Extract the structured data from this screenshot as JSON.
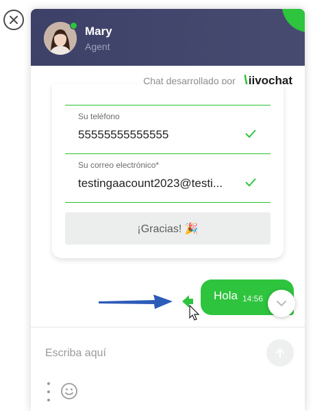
{
  "header": {
    "agent_name": "Mary",
    "agent_role": "Agent",
    "status_color": "#2ec43e"
  },
  "branding": {
    "powered_by": "Chat desarrollado por",
    "brand_name": "jivochat"
  },
  "contact_form": {
    "fields": [
      {
        "label": "Su teléfono",
        "value": "55555555555555",
        "status": "check-icon"
      },
      {
        "label": "Su correo electrónico*",
        "value": "testingaacount2023@testi...",
        "status": "check-icon"
      }
    ],
    "submit_label": "¡Gracias! 🎉"
  },
  "messages": [
    {
      "text": "Hola",
      "time": "14:56",
      "sender": "visitor"
    }
  ],
  "composer": {
    "placeholder": "Escriba aquí"
  },
  "colors": {
    "accent": "#2ec43e",
    "header_bg": "#3d4168"
  }
}
